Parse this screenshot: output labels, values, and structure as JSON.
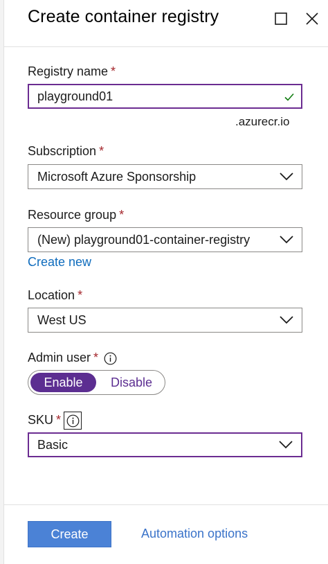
{
  "panel": {
    "title": "Create container registry"
  },
  "registry_name": {
    "label": "Registry name",
    "required": "*",
    "value": "playground01",
    "suffix": ".azurecr.io"
  },
  "subscription": {
    "label": "Subscription",
    "required": "*",
    "value": "Microsoft Azure Sponsorship"
  },
  "resource_group": {
    "label": "Resource group",
    "required": "*",
    "value": "(New) playground01-container-registry",
    "create_new": "Create new"
  },
  "location": {
    "label": "Location",
    "required": "*",
    "value": "West US"
  },
  "admin_user": {
    "label": "Admin user",
    "required": "*",
    "options": [
      "Enable",
      "Disable"
    ],
    "selected": "Enable"
  },
  "sku": {
    "label": "SKU",
    "required": "*",
    "value": "Basic"
  },
  "footer": {
    "create_label": "Create",
    "automation_label": "Automation options"
  },
  "colors": {
    "accent": "#5c2e91",
    "primary_button": "#4b82d6",
    "link": "#0f6cbd",
    "required": "#a4262c",
    "valid_check": "#107c10"
  },
  "icons": {
    "maximize": "maximize-icon",
    "close": "close-icon",
    "check": "check-icon",
    "chevron": "chevron-down-icon",
    "info": "info-icon"
  }
}
